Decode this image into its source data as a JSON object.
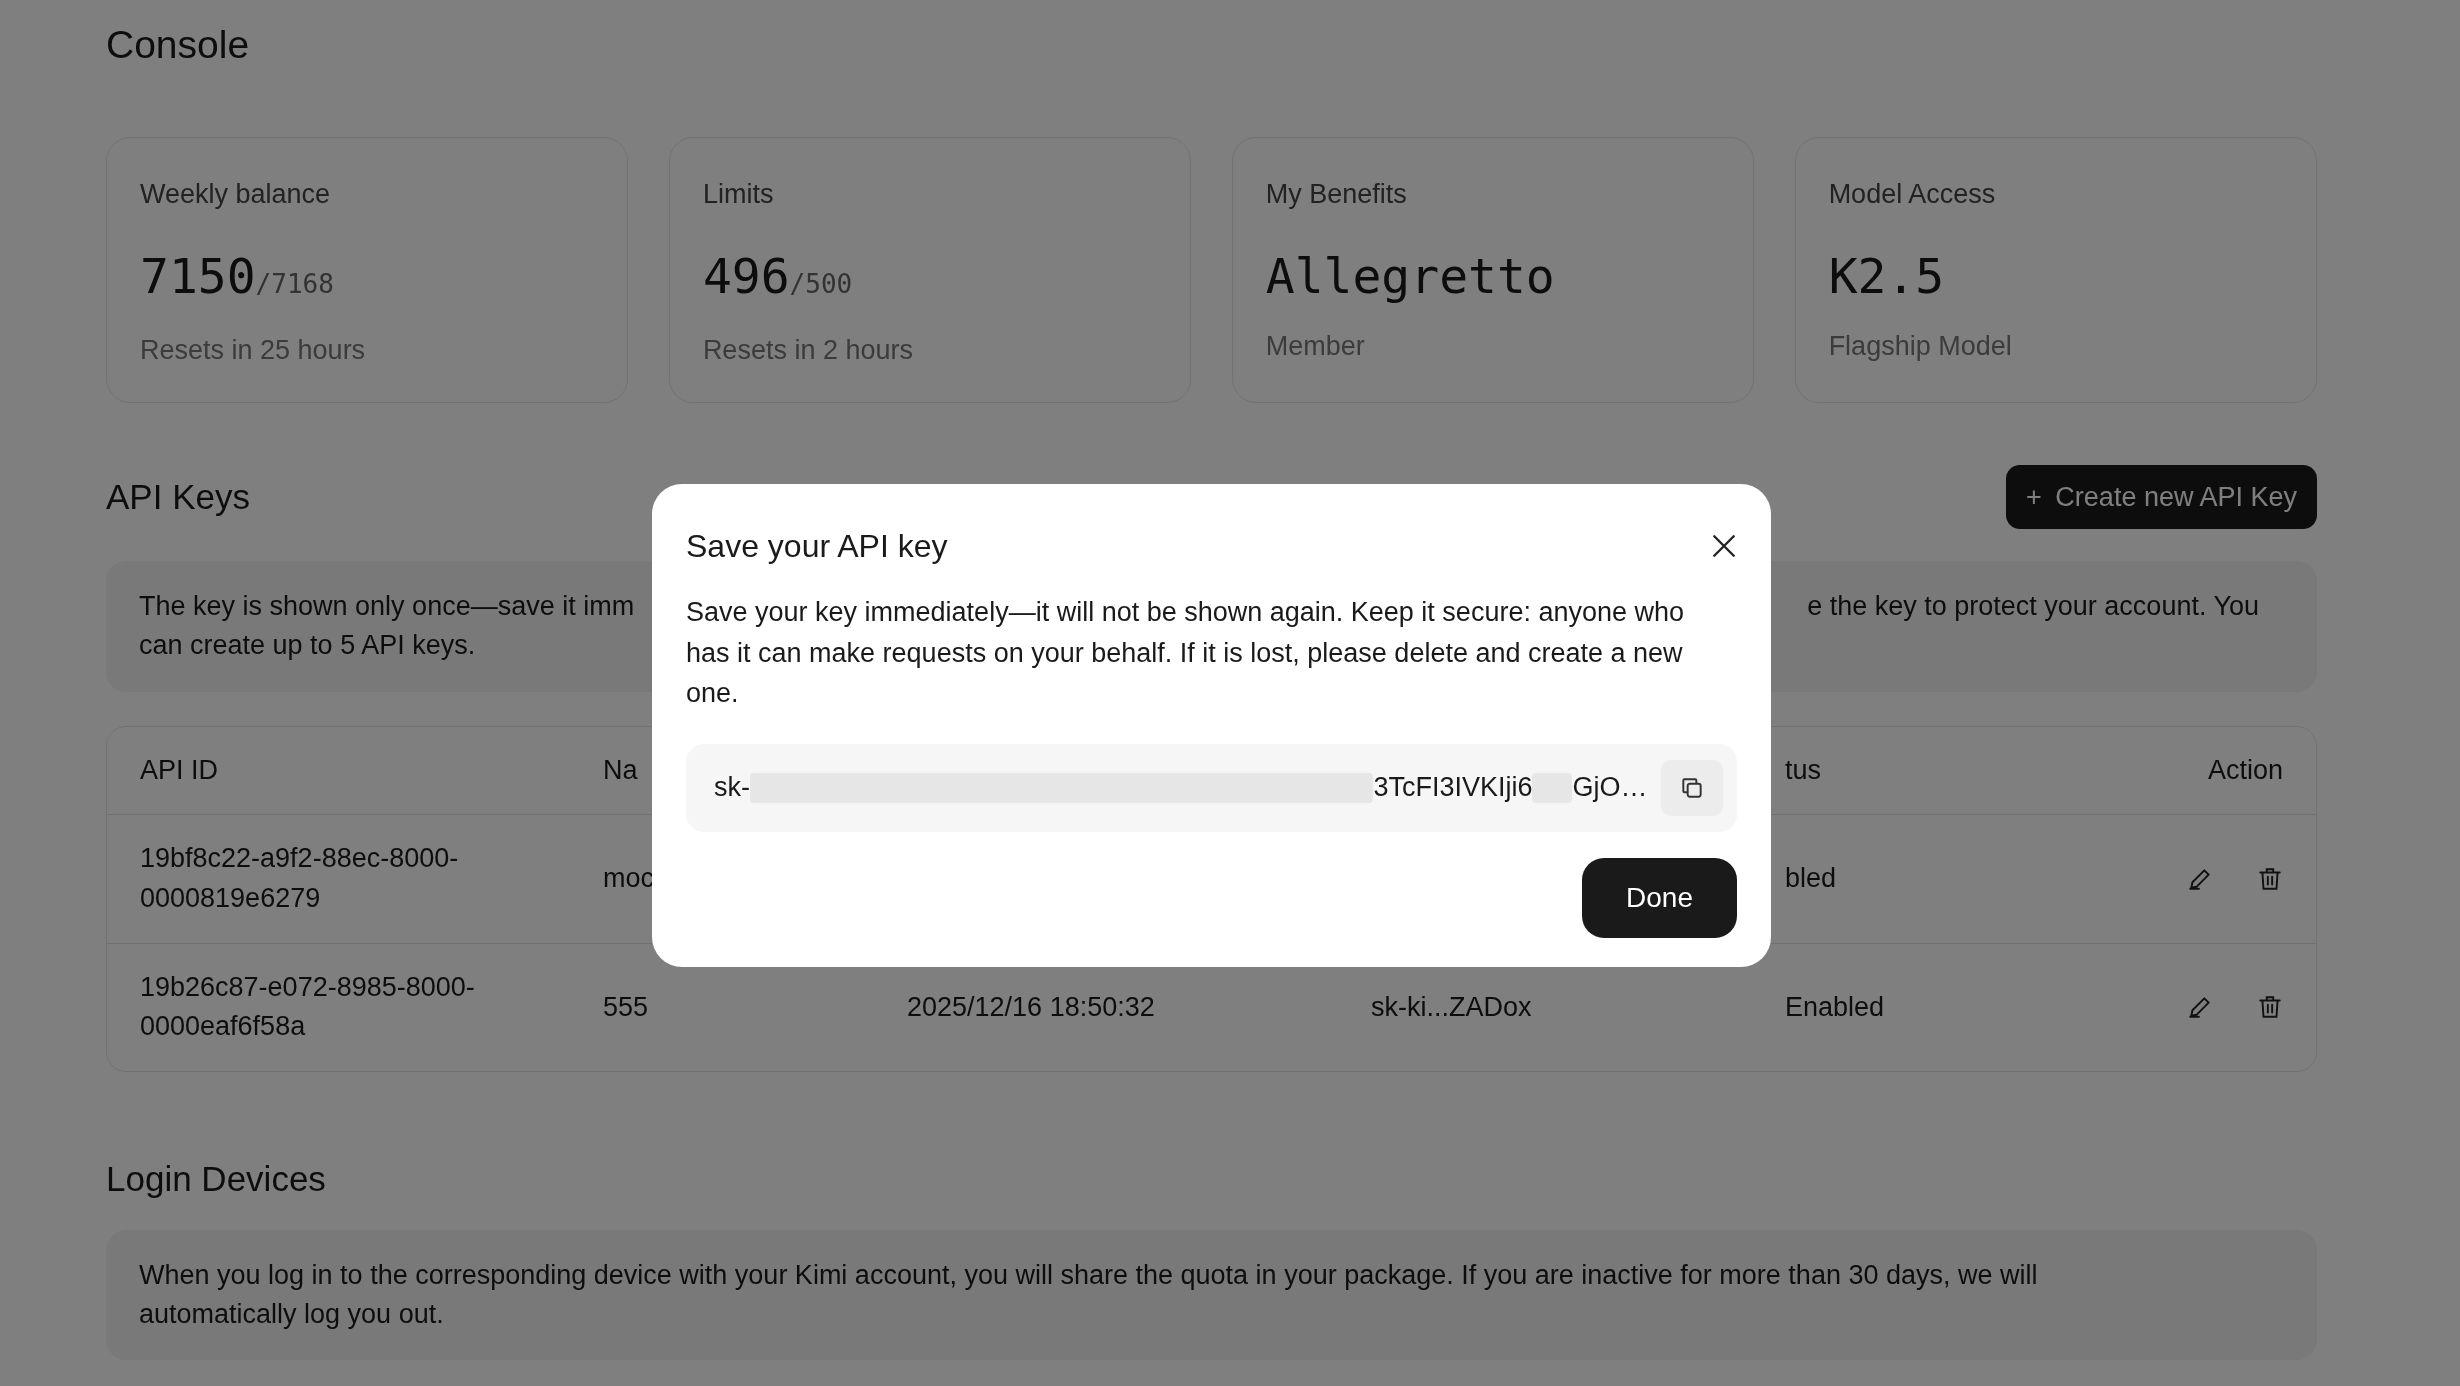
{
  "page": {
    "title": "Console"
  },
  "cards": [
    {
      "label": "Weekly balance",
      "value": "7150",
      "total": "/7168",
      "note": "Resets in 25 hours"
    },
    {
      "label": "Limits",
      "value": "496",
      "total": "/500",
      "note": "Resets in 2 hours"
    },
    {
      "label": "My Benefits",
      "value": "Allegretto",
      "note": "Member"
    },
    {
      "label": "Model Access",
      "value": "K2.5",
      "note": "Flagship Model"
    }
  ],
  "api_keys": {
    "title": "API Keys",
    "create_button": {
      "icon": "+",
      "label": "Create new API Key"
    },
    "notice": "The key is shown only once—save it imm",
    "notice_tail": "e the key to protect your account. You",
    "notice_line2": "can create up to 5 API keys.",
    "table": {
      "columns": [
        {
          "label": "API ID"
        },
        {
          "label": "Na"
        },
        {},
        {},
        {
          "label": "tus"
        },
        {
          "label": "Action"
        }
      ],
      "rows": [
        {
          "cells": [
            {
              "text": "19bf8c22-a9f2-88ec-8000-0000819e6279"
            },
            {
              "text": "moc"
            },
            {},
            {},
            {
              "text": "bled"
            }
          ]
        },
        {
          "cells": [
            {
              "text": "19b26c87-e072-8985-8000-0000eaf6f58a"
            },
            {
              "text": "555"
            },
            {
              "text": "2025/12/16 18:50:32"
            },
            {
              "text": "sk-ki...ZADox"
            },
            {
              "text": "Enabled"
            }
          ]
        }
      ]
    }
  },
  "login_devices": {
    "title": "Login Devices",
    "notice": "When you log in to the corresponding device with your Kimi account, you will share the quota in your package. If you are inactive for more than 30 days, we will automatically log you out."
  },
  "modal": {
    "title": "Save your API key",
    "body": "Save your key immediately—it will not be shown again. Keep it secure: anyone who has it can make requests on your behalf. If it is lost, please delete and create a new one.",
    "key_prefix": "sk-",
    "key_tail": "3TcFI3IVKIji6",
    "key_end": "GjO…",
    "done_button": "Done"
  }
}
